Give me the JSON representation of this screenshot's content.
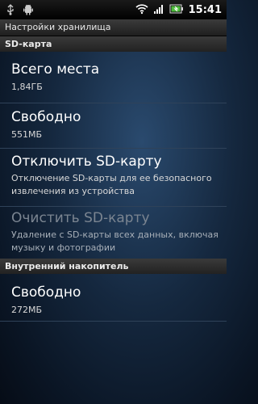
{
  "status_bar": {
    "time": "15:41",
    "icons_left": [
      "usb-icon",
      "android-icon"
    ],
    "icons_right": [
      "wifi-icon",
      "signal-icon",
      "battery-icon"
    ]
  },
  "title": "Настройки хранилища",
  "sd_section": {
    "header": "SD-карта",
    "items": [
      {
        "title": "Всего места",
        "summary": "1,84ГБ"
      },
      {
        "title": "Свободно",
        "summary": "551МБ"
      },
      {
        "title": "Отключить SD-карту",
        "summary_line1": "Отключение SD-карты для ее безопасного",
        "summary_line2": "извлечения из устройства"
      },
      {
        "title": "Очистить SD-карту",
        "summary_line1": "Удаление с SD-карты всех данных, включая",
        "summary_line2": "музыку и фотографии",
        "disabled": true
      }
    ]
  },
  "internal_section": {
    "header": "Внутренний накопитель",
    "items": [
      {
        "title": "Свободно",
        "summary": "272МБ"
      }
    ]
  },
  "colors": {
    "background": "#15283f",
    "disabled_text": "#7b8591"
  }
}
